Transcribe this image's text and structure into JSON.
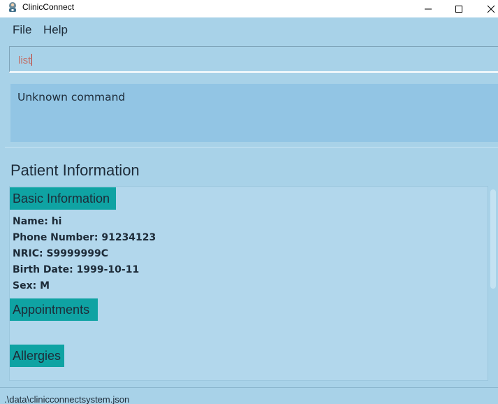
{
  "window": {
    "title": "ClinicConnect"
  },
  "menu": {
    "file": "File",
    "help": "Help"
  },
  "command": {
    "value": "list"
  },
  "result": {
    "message": "Unknown command"
  },
  "patient": {
    "section_title": "Patient Information",
    "basic_header": "Basic Information",
    "fields": [
      "Name: hi",
      "Phone Number: 91234123",
      "NRIC: S9999999C",
      "Birth Date: 1999-10-11",
      "Sex: M"
    ],
    "appointments_header": "Appointments",
    "allergies_header": "Allergies"
  },
  "status": {
    "path": ".\\data\\clinicconnectsystem.json"
  },
  "colors": {
    "background": "#a8d2e8",
    "result_box": "#92c5e4",
    "panel": "#b2d7ec",
    "tag": "#0fa3a3",
    "command_text": "#c0736d"
  },
  "icons": {
    "app": "clinic-app-icon",
    "minimize": "minimize-icon",
    "maximize": "maximize-icon",
    "close": "close-icon"
  }
}
